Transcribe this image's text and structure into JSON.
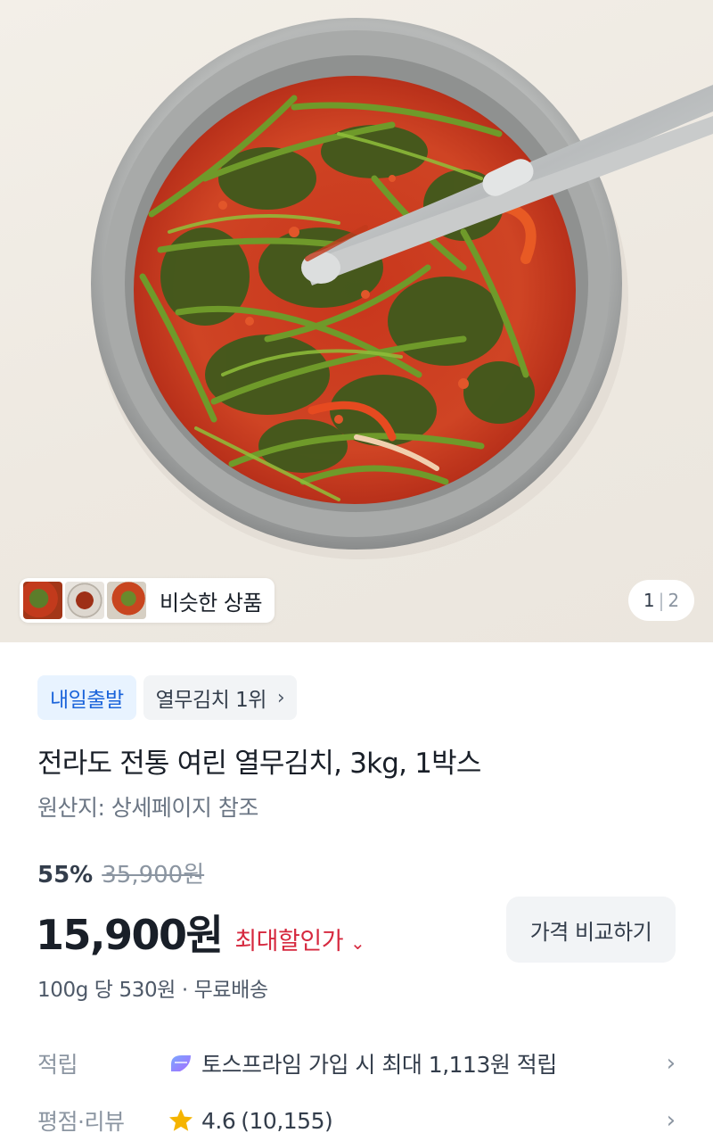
{
  "gallery": {
    "similar_label": "비슷한 상품",
    "current_page": "1",
    "page_separator": "|",
    "total_pages": "2"
  },
  "badges": {
    "delivery": "내일출발",
    "rank": "열무김치 1위",
    "rank_chevron": "›"
  },
  "product": {
    "title": "전라도 전통 여린 열무김치, 3kg, 1박스",
    "origin": "원산지: 상세페이지 참조",
    "discount_rate": "55%",
    "original_price": "35,900원",
    "price": "15,900원",
    "best_price_label": "최대할인가",
    "best_price_chevron": "⌄",
    "compare_button": "가격 비교하기",
    "unit_price": "100g 당 530원 · 무료배송"
  },
  "points": {
    "label": "적립",
    "icon": "toss-prime-icon",
    "text": "토스프라임 가입 시 최대 1,113원 적립",
    "arrow": "›"
  },
  "review": {
    "label": "평점·리뷰",
    "icon": "star-icon",
    "rating": "4.6",
    "count": "(10,155)",
    "arrow": "›"
  },
  "colors": {
    "delivery_bg": "#e8f3ff",
    "delivery_text": "#1b64da",
    "best_price": "#d6293f",
    "star": "#f5b400"
  }
}
